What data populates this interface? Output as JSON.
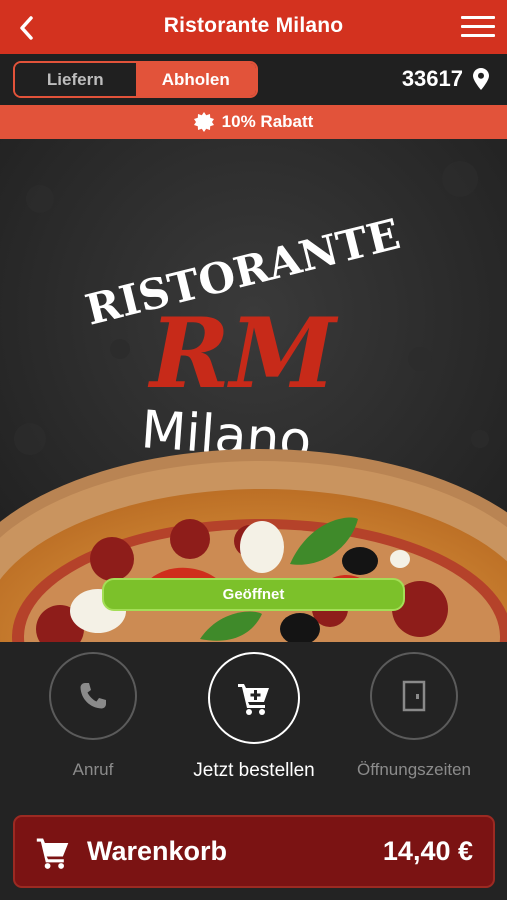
{
  "header": {
    "title": "Ristorante Milano"
  },
  "order_mode": {
    "options": [
      "Liefern",
      "Abholen"
    ],
    "selected": "Abholen"
  },
  "location": {
    "zip": "33617"
  },
  "promo": {
    "label": "10% Rabatt"
  },
  "hero": {
    "logo_top": "RISTORANTE",
    "logo_monogram": "RM",
    "logo_bottom": "Milano",
    "status": "Geöffnet"
  },
  "actions": [
    {
      "label": "Anruf",
      "icon": "phone-icon"
    },
    {
      "label": "Jetzt bestellen",
      "icon": "cart-icon"
    },
    {
      "label": "Öffnungszeiten",
      "icon": "door-icon"
    }
  ],
  "cart": {
    "label": "Warenkorb",
    "total": "14,40 €"
  },
  "colors": {
    "header": "#d3321f",
    "accent": "#e2533a",
    "open": "#7cc12a",
    "cart": "#7b1313"
  }
}
